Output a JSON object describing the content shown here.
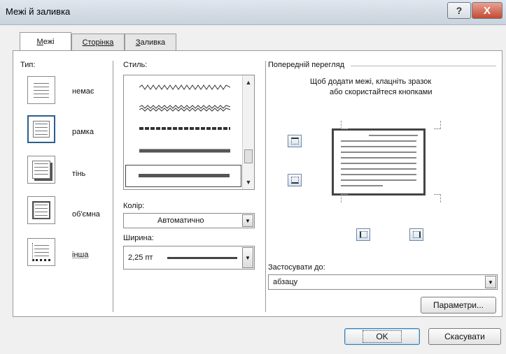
{
  "window": {
    "title": "Межі й заливка"
  },
  "tabs": [
    {
      "label": "Межі",
      "hotkey": "М",
      "rest": "ежі"
    },
    {
      "label": "Сторінка",
      "hotkey": "С",
      "rest": "торінка"
    },
    {
      "label": "Заливка",
      "hotkey": "З",
      "rest": "аливка"
    }
  ],
  "type": {
    "label": "Тип:",
    "items": [
      {
        "label": "немає",
        "icon": "none-border-icon"
      },
      {
        "label": "рамка",
        "icon": "box-border-icon",
        "selected": true
      },
      {
        "label": "тінь",
        "icon": "shadow-border-icon"
      },
      {
        "label": "об'ємна",
        "icon": "3d-border-icon"
      },
      {
        "label": "інша",
        "icon": "custom-border-icon"
      }
    ]
  },
  "style": {
    "label": "Стиль:"
  },
  "color": {
    "label": "Колір:",
    "value": "Автоматично"
  },
  "width": {
    "label": "Ширина:",
    "value": "2,25 пт"
  },
  "preview": {
    "label": "Попередній перегляд",
    "hint_line1": "Щоб додати межі, клацніть зразок",
    "hint_line2": "або скористайтеся кнопками"
  },
  "apply": {
    "label": "Застосувати до:",
    "value": "абзацу"
  },
  "buttons": {
    "options": "Параметри...",
    "ok": "OK",
    "cancel": "Скасувати",
    "help": "?",
    "close": "X"
  },
  "colors": {
    "selected_border": "#2b5f8d",
    "close_button": "#c44a33",
    "panel_bg": "#ffffff",
    "dialog_bg": "#f0f0f0"
  }
}
